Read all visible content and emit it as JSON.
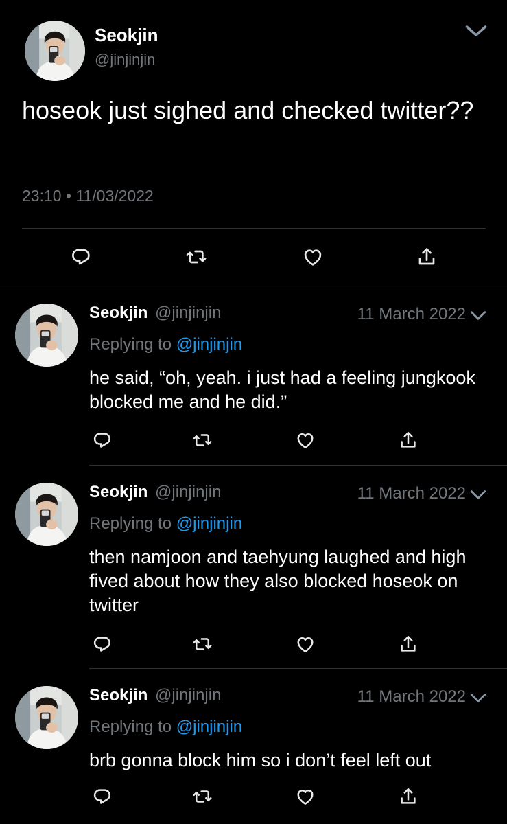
{
  "main_tweet": {
    "name": "Seokjin",
    "handle": "@jinjinjin",
    "text": "hoseok just sighed and checked twitter??",
    "timestamp": "23:10 • 11/03/2022",
    "icons": [
      "reply-icon",
      "retweet-icon",
      "like-icon",
      "share-icon",
      "chevron-down-icon"
    ]
  },
  "replies": [
    {
      "name": "Seokjin",
      "handle": "@jinjinjin",
      "date": "11 March 2022",
      "replying_prefix": "Replying to",
      "replying_to": "@jinjinjin",
      "text": "he said, “oh, yeah. i just had a feeling jungkook blocked me and he did.”"
    },
    {
      "name": "Seokjin",
      "handle": "@jinjinjin",
      "date": "11 March 2022",
      "replying_prefix": "Replying to",
      "replying_to": "@jinjinjin",
      "text": "then namjoon and taehyung laughed and high fived about how they also blocked hoseok on twitter"
    },
    {
      "name": "Seokjin",
      "handle": "@jinjinjin",
      "date": "11 March 2022",
      "replying_prefix": "Replying to",
      "replying_to": "@jinjinjin",
      "text": "brb gonna block him so i don’t feel left out"
    }
  ],
  "colors": {
    "background": "#000000",
    "text": "#ffffff",
    "secondary_text": "#71767b",
    "link": "#1d9bf0",
    "divider": "#2f3336",
    "icon": "#e7e9ea"
  }
}
